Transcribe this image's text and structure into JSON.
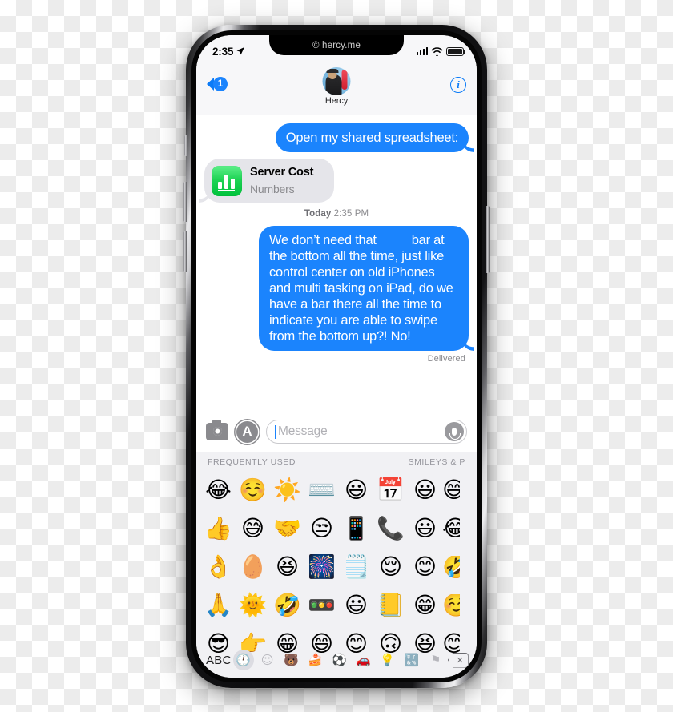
{
  "watermark": "© hercy.me",
  "status_bar": {
    "time": "2:35",
    "location_icon": "location-arrow-icon",
    "signal_icon": "cellular-signal-icon",
    "wifi_icon": "wifi-icon",
    "battery_icon": "battery-full-icon"
  },
  "nav_bar": {
    "back_icon": "chevron-left-icon",
    "unread_count": "1",
    "contact_name": "Hercy",
    "avatar_icon": "contact-avatar",
    "info_label": "i"
  },
  "conversation": {
    "messages": [
      {
        "id": "spreadsheet-invite",
        "side": "outgoing",
        "text": "Open my shared spreadsheet:"
      },
      {
        "id": "numbers-attachment",
        "side": "incoming",
        "title": "Server Cost",
        "subtitle": "Numbers",
        "icon": "numbers-app-icon"
      }
    ],
    "timestamp_day": "Today",
    "timestamp_time": "2:35 PM",
    "long_message": {
      "side": "outgoing",
      "part1": "We don’t need that",
      "part2": "bar at the bottom all the time, just like control center on old iPhones and multi tasking on iPad, do we have a bar there all the time to indicate you are able to swipe from the bottom up?! No!"
    },
    "delivered_label": "Delivered"
  },
  "input_bar": {
    "camera_icon": "camera-icon",
    "appstore_icon": "app-store-icon",
    "appstore_glyph": "A",
    "message_placeholder": "Message",
    "message_value": "",
    "mic_icon": "microphone-icon"
  },
  "emoji_keyboard": {
    "section_left": "FREQUENTLY USED",
    "section_right": "SMILEYS & P",
    "rows": [
      [
        "😂",
        "☺️",
        "☀️",
        "⌨️",
        "😃",
        "📅",
        "😃",
        "😅"
      ],
      [
        "👍",
        "😅",
        "🤝",
        "😒",
        "📱",
        "📞",
        "😃",
        "😂"
      ],
      [
        "👌",
        "🥚",
        "😆",
        "🎆",
        "🗒️",
        "😌",
        "😊",
        "🤣"
      ],
      [
        "🙏",
        "🌞",
        "🤣",
        "🚥",
        "😃",
        "📒",
        "😁",
        "☺️"
      ],
      [
        "😎",
        "👉",
        "😁",
        "😄",
        "😊",
        "🙃",
        "😆",
        "😊"
      ]
    ],
    "toolbar": {
      "abc_label": "ABC",
      "categories": [
        {
          "name": "recent-clock-icon",
          "glyph": "🕐",
          "selected": true
        },
        {
          "name": "smileys-icon",
          "glyph": "☺",
          "selected": false
        },
        {
          "name": "animals-icon",
          "glyph": "🐻",
          "selected": false
        },
        {
          "name": "food-icon",
          "glyph": "🍰",
          "selected": false
        },
        {
          "name": "activity-icon",
          "glyph": "⚽",
          "selected": false
        },
        {
          "name": "travel-icon",
          "glyph": "🚗",
          "selected": false
        },
        {
          "name": "objects-icon",
          "glyph": "💡",
          "selected": false
        },
        {
          "name": "symbols-icon",
          "glyph": "🔣",
          "selected": false
        },
        {
          "name": "flags-icon",
          "glyph": "⚑",
          "selected": false
        }
      ],
      "delete_icon": "delete-backspace-icon",
      "delete_glyph": "✕"
    }
  },
  "colors": {
    "imessage_blue": "#1b84fd",
    "gray_bubble": "#e5e5ea",
    "tint_blue": "#0b7bf7",
    "numbers_green": "#1fd355",
    "keyboard_bg": "#f1f1f4"
  }
}
